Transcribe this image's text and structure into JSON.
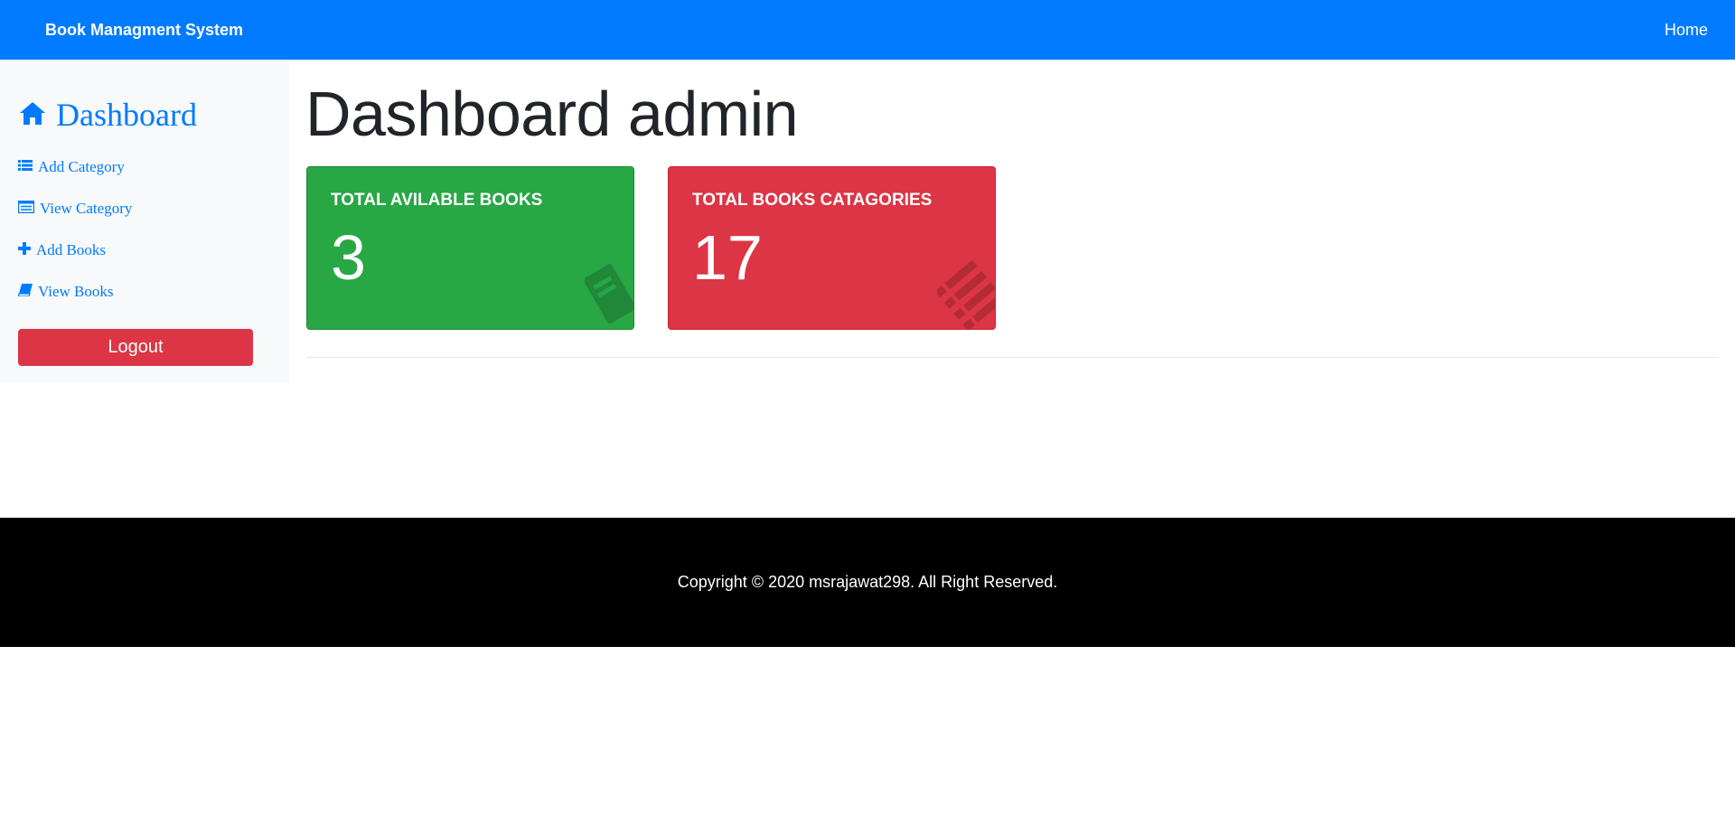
{
  "navbar": {
    "brand": "Book Managment System",
    "home_link": "Home"
  },
  "sidebar": {
    "title": "Dashboard",
    "title_icon": "home-icon",
    "items": [
      {
        "label": "Add Category",
        "icon": "list-icon"
      },
      {
        "label": "View Category",
        "icon": "table-list-icon"
      },
      {
        "label": "Add Books",
        "icon": "plus-icon"
      },
      {
        "label": "View Books",
        "icon": "book-icon"
      }
    ],
    "logout_label": "Logout"
  },
  "main": {
    "title": "Dashboard admin",
    "cards": [
      {
        "title": "TOTAL AVILABLE BOOKS",
        "value": "3",
        "color": "#28a745",
        "icon": "book-icon"
      },
      {
        "title": "TOTAL BOOKS CATAGORIES",
        "value": "17",
        "color": "#dc3545",
        "icon": "list-icon"
      }
    ]
  },
  "footer": {
    "text": "Copyright © 2020 msrajawat298. All Right Reserved."
  },
  "colors": {
    "primary": "#007bff",
    "success": "#28a745",
    "danger": "#dc3545",
    "footer_bg": "#000000"
  }
}
